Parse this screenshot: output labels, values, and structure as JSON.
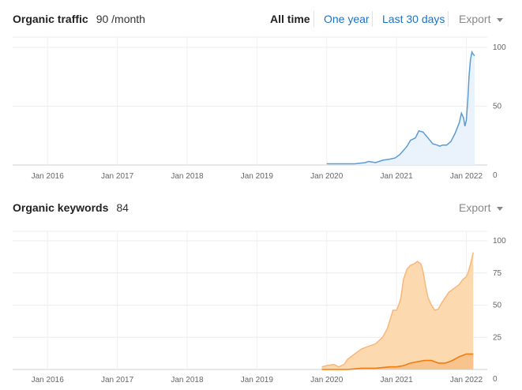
{
  "traffic": {
    "title": "Organic traffic",
    "value": "90 /month",
    "range_options": [
      "All time",
      "One year",
      "Last 30 days"
    ],
    "active_range": "All time",
    "export_label": "Export"
  },
  "keywords": {
    "title": "Organic keywords",
    "value": "84",
    "export_label": "Export"
  },
  "colors": {
    "traffic_line": "#5b9bd5",
    "traffic_fill": "#eaf2fc",
    "keywords_top_fill": "#fdd9b0",
    "keywords_top_line": "#f8b77a",
    "keywords_bottom_fill": "#f9c38d",
    "keywords_bottom_line": "#ef7d0f",
    "link": "#1a73c8"
  },
  "chart_data": [
    {
      "type": "area",
      "x_ticks": [
        "Jan 2016",
        "Jan 2017",
        "Jan 2018",
        "Jan 2019",
        "Jan 2020",
        "Jan 2021",
        "Jan 2022"
      ],
      "y_ticks": [
        "100",
        "50",
        "0"
      ],
      "ylim": [
        0,
        100
      ],
      "xlim": [
        2015.5,
        2022.3
      ],
      "series": [
        {
          "x": [
            2020.0,
            2020.4,
            2020.55,
            2020.6,
            2020.7,
            2020.8,
            2020.9,
            2020.98,
            2021.05,
            2021.15,
            2021.2,
            2021.27,
            2021.32,
            2021.38,
            2021.45,
            2021.52,
            2021.58,
            2021.62,
            2021.66,
            2021.72,
            2021.78,
            2021.84,
            2021.9,
            2021.93,
            2021.96,
            2021.98,
            2022.0,
            2022.02,
            2022.04,
            2022.06,
            2022.08,
            2022.1,
            2022.12
          ],
          "y": [
            1,
            1,
            2,
            3,
            2,
            4,
            5,
            6,
            9,
            16,
            21,
            23,
            29,
            28,
            23,
            18,
            17,
            16,
            17,
            17,
            20,
            27,
            36,
            44,
            40,
            33,
            38,
            55,
            76,
            90,
            96,
            94,
            93
          ]
        }
      ]
    },
    {
      "type": "area",
      "x_ticks": [
        "Jan 2016",
        "Jan 2017",
        "Jan 2018",
        "Jan 2019",
        "Jan 2020",
        "Jan 2021",
        "Jan 2022"
      ],
      "y_ticks": [
        "100",
        "75",
        "50",
        "25",
        "0"
      ],
      "ylim": [
        0,
        100
      ],
      "xlim": [
        2015.5,
        2022.3
      ],
      "series": [
        {
          "x": [
            2019.93,
            2020.0,
            2020.1,
            2020.17,
            2020.25,
            2020.3,
            2020.4,
            2020.5,
            2020.6,
            2020.7,
            2020.8,
            2020.87,
            2020.95,
            2021.0,
            2021.03,
            2021.06,
            2021.1,
            2021.15,
            2021.2,
            2021.25,
            2021.3,
            2021.35,
            2021.38,
            2021.42,
            2021.45,
            2021.5,
            2021.55,
            2021.6,
            2021.65,
            2021.7,
            2021.75,
            2021.8,
            2021.85,
            2021.9,
            2021.95,
            2022.0,
            2022.03,
            2022.06,
            2022.1
          ],
          "y": [
            2,
            3,
            4,
            2,
            4,
            8,
            12,
            16,
            18,
            20,
            25,
            32,
            46,
            46,
            50,
            55,
            70,
            78,
            81,
            82,
            84,
            82,
            76,
            64,
            56,
            50,
            46,
            47,
            52,
            56,
            60,
            62,
            64,
            66,
            70,
            72,
            76,
            82,
            91
          ]
        },
        {
          "x": [
            2019.93,
            2020.3,
            2020.5,
            2020.7,
            2020.9,
            2021.0,
            2021.1,
            2021.2,
            2021.3,
            2021.4,
            2021.5,
            2021.55,
            2021.6,
            2021.7,
            2021.8,
            2021.9,
            2021.95,
            2022.0,
            2022.1
          ],
          "y": [
            0,
            0,
            1,
            1,
            2,
            2,
            3,
            5,
            6,
            7,
            7,
            6,
            5,
            5,
            7,
            10,
            11,
            12,
            12
          ]
        }
      ]
    }
  ]
}
